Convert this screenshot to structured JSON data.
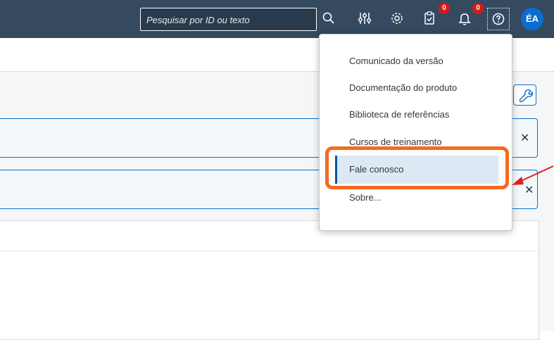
{
  "topbar": {
    "search": {
      "placeholder": "Pesquisar por ID ou texto"
    },
    "icons": {
      "search": "search-icon",
      "filters": "sliders-icon",
      "settings": "gear-icon",
      "tasks": "clipboard-check-icon",
      "notifications": "bell-icon",
      "help": "question-circle-icon"
    },
    "tasks_badge": "0",
    "notifications_badge": "0",
    "avatar_initials": "ÉA"
  },
  "help_menu": {
    "items": [
      {
        "label": "Comunicado da versão",
        "selected": false
      },
      {
        "label": "Documentação do produto",
        "selected": false
      },
      {
        "label": "Biblioteca de referências",
        "selected": false
      },
      {
        "label": "Cursos de treinamento",
        "selected": false
      },
      {
        "label": "Fale conosco",
        "selected": true
      },
      {
        "label": "Sobre...",
        "selected": false
      }
    ]
  },
  "content": {
    "close_glyph": "✕",
    "tool_icon": "wrench-icon"
  },
  "colors": {
    "shell_header": "#354a5f",
    "accent": "#0a6ed1",
    "badge": "#d81818",
    "callout": "#f36b21",
    "arrow": "#e02020"
  }
}
